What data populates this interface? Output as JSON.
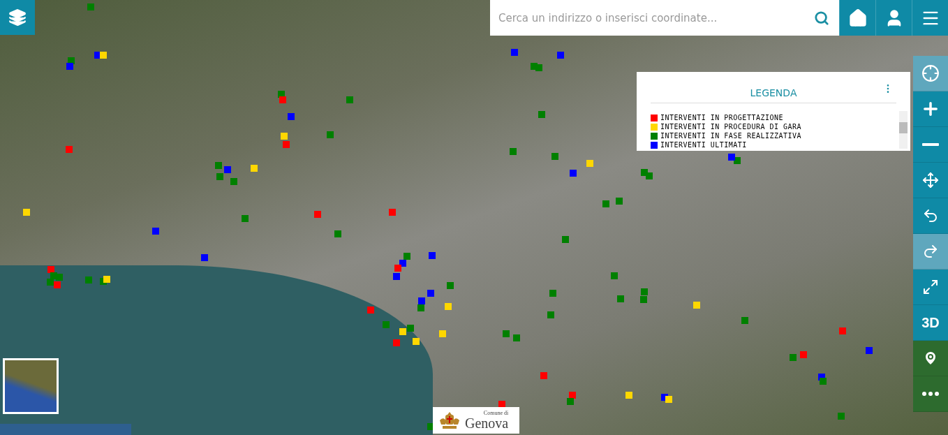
{
  "search": {
    "placeholder": "Cerca un indirizzo o inserisci coordinate..."
  },
  "top_buttons": [
    {
      "kind": "home"
    },
    {
      "kind": "user"
    },
    {
      "kind": "menu"
    }
  ],
  "legend": {
    "title": "LEGENDA",
    "items": [
      {
        "label": "INTERVENTI IN PROGETTAZIONE",
        "color": "#ff0000"
      },
      {
        "label": "INTERVENTI IN PROCEDURA DI GARA",
        "color": "#ffd700"
      },
      {
        "label": "INTERVENTI IN FASE REALIZZATIVA",
        "color": "#008000"
      },
      {
        "label": "INTERVENTI ULTIMATI",
        "color": "#0000ff"
      }
    ]
  },
  "side_tools": [
    {
      "kind": "locate",
      "active": true
    },
    {
      "kind": "zoom-in",
      "active": false
    },
    {
      "kind": "zoom-out",
      "active": false
    },
    {
      "kind": "extent",
      "active": false
    },
    {
      "kind": "back",
      "active": false
    },
    {
      "kind": "forward",
      "active": true
    },
    {
      "kind": "fullscreen",
      "active": false
    },
    {
      "kind": "perspective",
      "label": "3D",
      "active": false
    },
    {
      "kind": "pin"
    },
    {
      "kind": "more"
    }
  ],
  "logo": {
    "line_1": "Comune di",
    "line_2": "Genova"
  }
}
